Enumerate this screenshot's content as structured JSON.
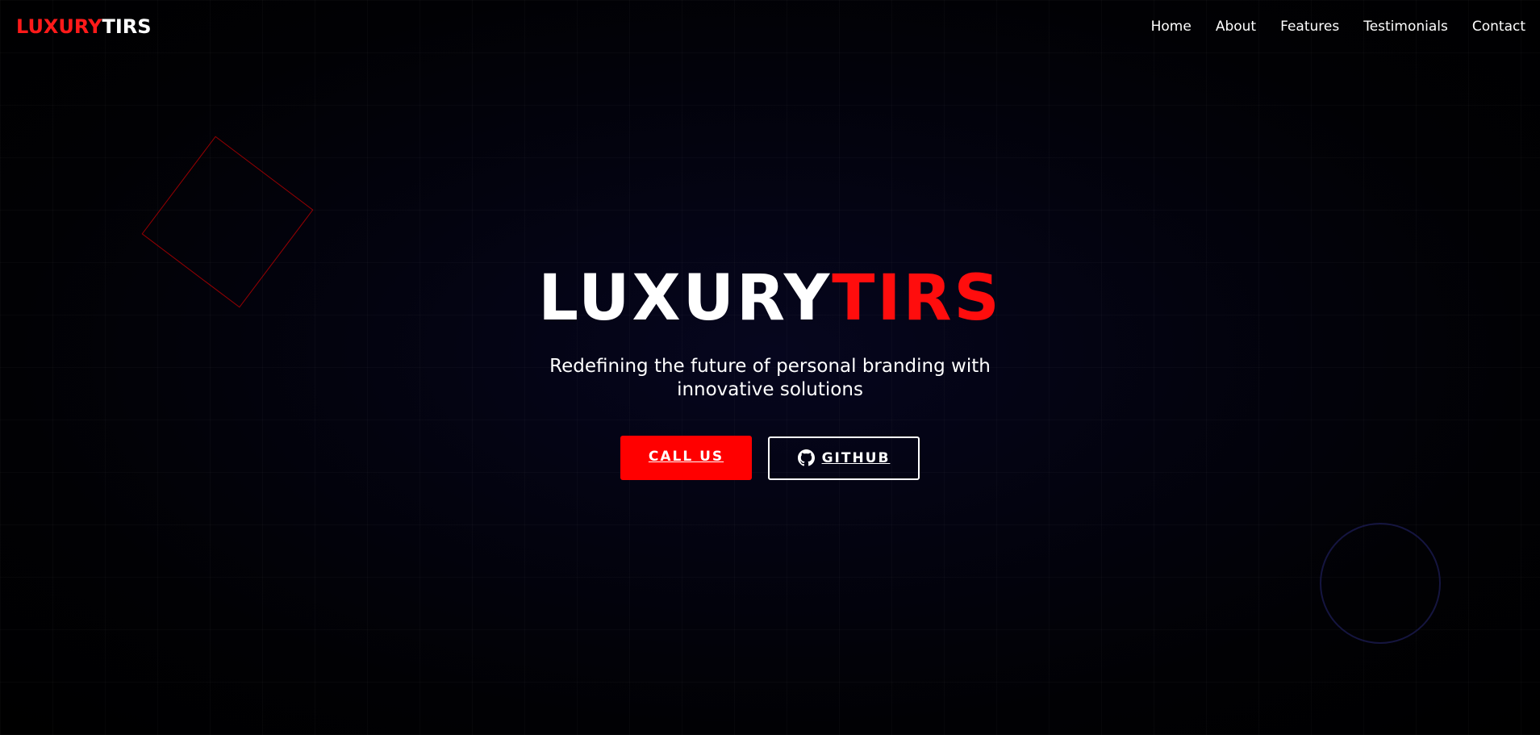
{
  "nav": {
    "brand_part1": "LUXURY",
    "brand_part2": "TIRS",
    "links": [
      "Home",
      "About",
      "Features",
      "Testimonials",
      "Contact"
    ]
  },
  "hero": {
    "title_part1": "LUXURY",
    "title_part2": "TIRS",
    "subtitle": "Redefining the future of personal branding with innovative solutions",
    "primary_button": "CALL US",
    "secondary_button": "GITHUB",
    "secondary_icon": "github-icon"
  },
  "colors": {
    "accent": "#ff0000",
    "background": "#03030f",
    "text": "#ffffff"
  }
}
